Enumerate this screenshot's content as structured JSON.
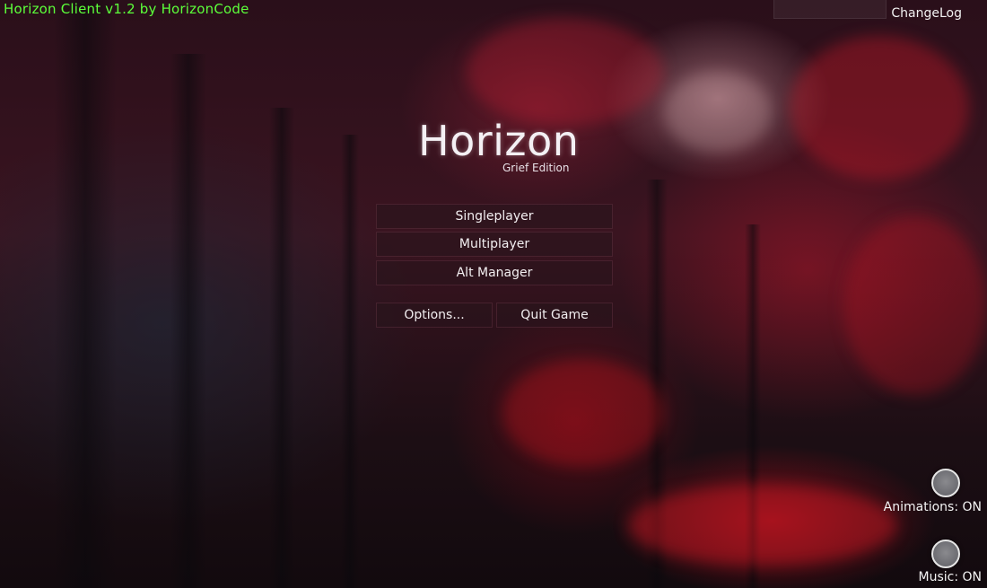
{
  "header": {
    "client_title": "Horizon Client v1.2 by HorizonCode",
    "changelog_label": "ChangeLog"
  },
  "logo": {
    "title": "Horizon",
    "subtitle": "Grief Edition"
  },
  "menu": {
    "singleplayer": "Singleplayer",
    "multiplayer": "Multiplayer",
    "alt_manager": "Alt Manager",
    "options": "Options...",
    "quit": "Quit Game"
  },
  "toggles": {
    "animations": "Animations: ON",
    "music": "Music: ON"
  },
  "colors": {
    "brand_text": "#5cff3a",
    "button_bg": "#28141c",
    "text": "#f2eef0"
  },
  "icons": {
    "animations_toggle": "circle-toggle-icon",
    "music_toggle": "circle-toggle-icon"
  }
}
